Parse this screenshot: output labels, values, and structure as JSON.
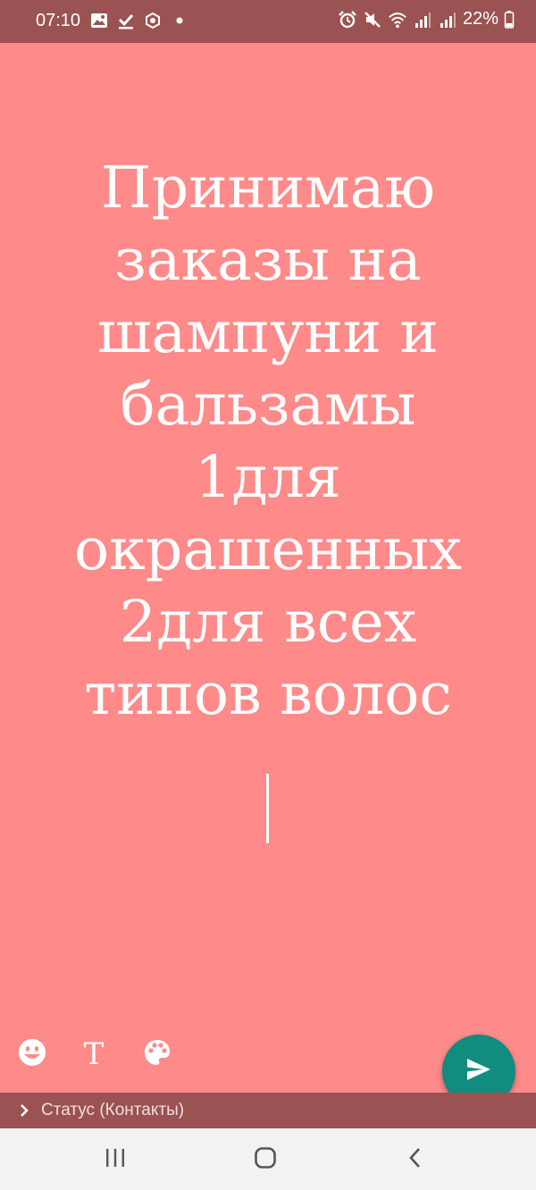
{
  "status_bar": {
    "time": "07:10",
    "battery": "22%",
    "left_icons": [
      "gallery-icon",
      "check-download-icon",
      "app-notification-icon",
      "dot-icon"
    ],
    "right_icons": [
      "alarm-icon",
      "mute-icon",
      "wifi-icon",
      "signal-icon",
      "signal-icon",
      "battery-icon"
    ]
  },
  "editor": {
    "text": "Принимаю\nзаказы на\nшампуни и\nбальзамы\n1для\nокрашенных\n2для всех\nтипов волос",
    "background_color": "#ff8a8a",
    "text_color": "#ffffff"
  },
  "toolbar": {
    "icons": [
      "emoji-icon",
      "text-style-icon",
      "palette-icon"
    ],
    "text_tool_glyph": "T",
    "send_icon": "send-icon",
    "send_color": "#128c7e"
  },
  "recipients": {
    "label": "Статус (Контакты)"
  },
  "navigation": {
    "icons": [
      "recent-apps-icon",
      "home-icon",
      "back-icon"
    ]
  }
}
